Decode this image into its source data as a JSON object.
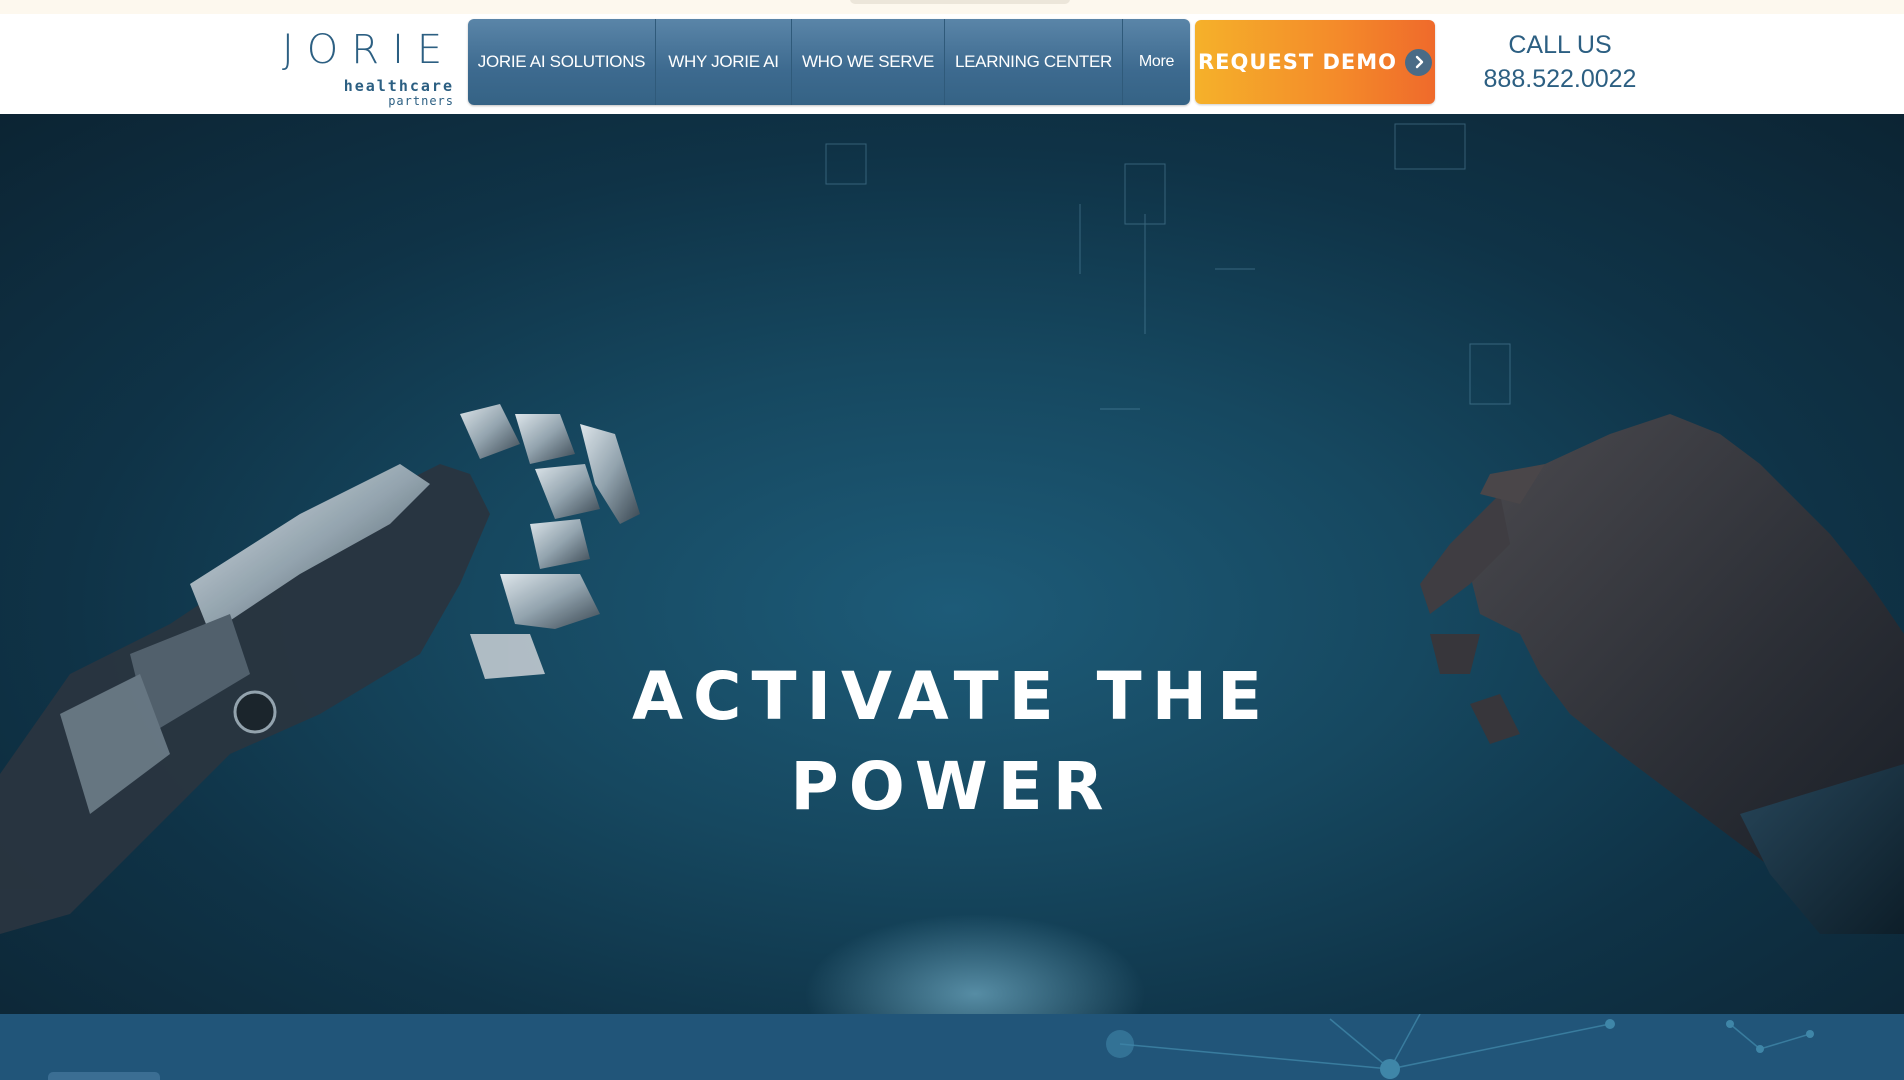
{
  "header": {
    "logo": {
      "wordmark": "JORIE",
      "line1": "healthcare",
      "line2": "partners"
    },
    "nav": {
      "items": [
        {
          "label": "JORIE AI SOLUTIONS"
        },
        {
          "label": "WHY JORIE AI"
        },
        {
          "label": "WHO WE SERVE"
        },
        {
          "label": "LEARNING CENTER"
        },
        {
          "label": "More"
        }
      ]
    },
    "cta": {
      "label": "REQUEST DEMO",
      "icon": "chevron-right-icon"
    },
    "call": {
      "label": "CALL US",
      "number": "888.522.0022"
    }
  },
  "hero": {
    "title_line1": "ACTIVATE THE",
    "title_line2": "POWER",
    "image": "robot-hand-reaching-human-hand"
  },
  "colors": {
    "brand_blue": "#2c5f82",
    "nav_blue": "#3d6a8f",
    "cta_orange": "#f48a2a",
    "hero_dark": "#0f3347",
    "band_blue": "#215579"
  }
}
